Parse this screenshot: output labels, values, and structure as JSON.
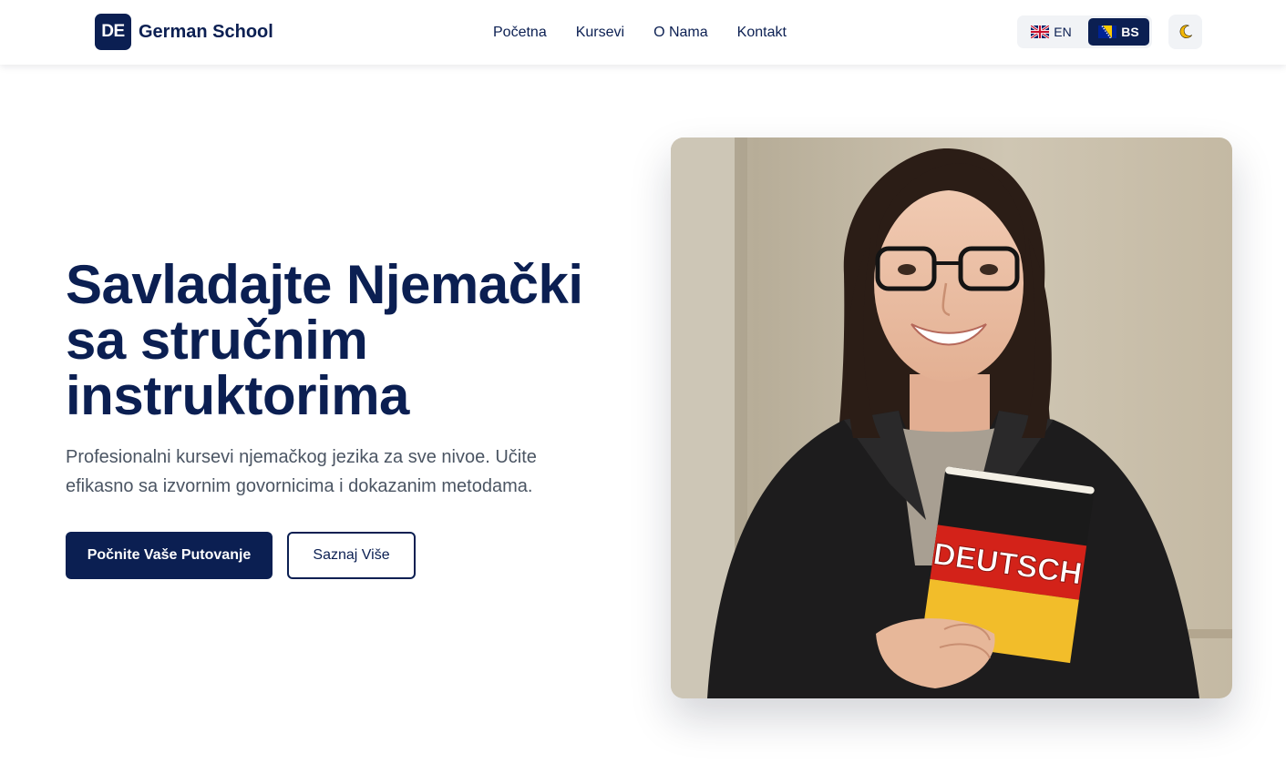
{
  "navbar": {
    "logo_badge": "DE",
    "logo_text": "German School",
    "links": [
      "Početna",
      "Kursevi",
      "O Nama",
      "Kontakt"
    ],
    "languages": {
      "en": "EN",
      "bs": "BS",
      "active": "BS"
    },
    "theme_icon": "moon-icon"
  },
  "hero": {
    "title": "Savladajte Njemački sa stručnim instruktorima",
    "subtitle": "Profesionalni kursevi njemačkog jezika za sve nivoe. Učite efikasno sa izvornim govornicima i dokazanim metodama.",
    "primary_button": "Počnite Vaše Putovanje",
    "secondary_button": "Saznaj Više",
    "image_book_text": "DEUTSCH"
  },
  "colors": {
    "brand_navy": "#0b1f52",
    "text_gray": "#4b5563",
    "toggle_bg": "#f1f3f6"
  }
}
